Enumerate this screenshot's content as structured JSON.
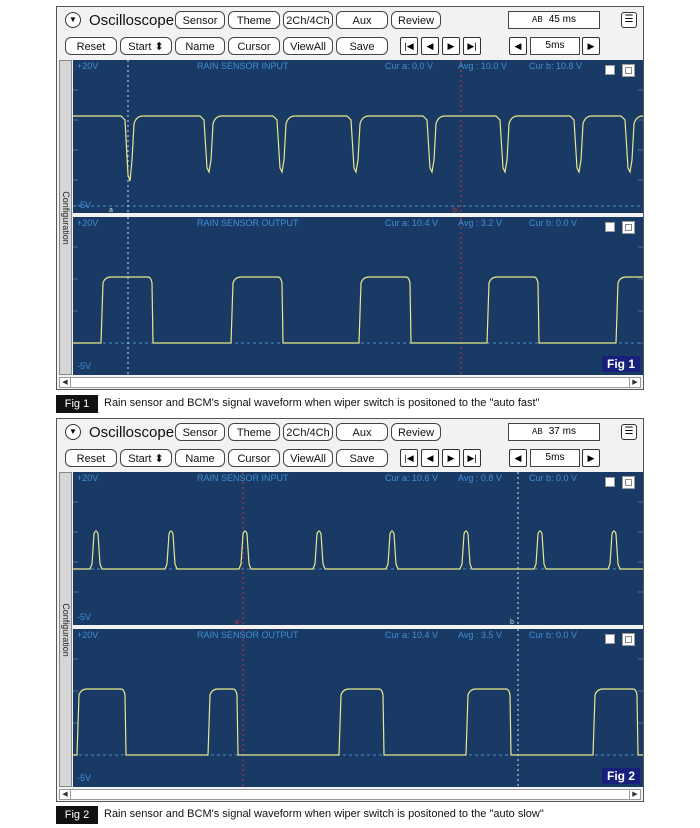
{
  "toolbar": {
    "dropdown_icon": "dropdown-circle-icon",
    "title": "Oscilloscope",
    "buttons": [
      "Sensor",
      "Theme",
      "2Ch/4Ch",
      "Aux",
      "Review"
    ],
    "row2_buttons": [
      "Reset",
      "Start",
      "Name",
      "Cursor",
      "ViewAll",
      "Save"
    ],
    "start_arrows": "⬍",
    "nav_icons": [
      "first-icon",
      "prev-icon",
      "next-icon",
      "last-icon"
    ],
    "time_div": "5ms",
    "menu_icon": "list-menu-icon"
  },
  "sidebar_label": "Configuration",
  "figures": [
    {
      "time_readout": "45 ms",
      "channels": [
        {
          "top_label": "+20V",
          "bottom_label": "-5V",
          "name": "RAIN SENSOR INPUT",
          "cur_a": "Cur a: 0.0 V",
          "avg": "Avg : 10.0 V",
          "cur_b": "Cur b: 10.8 V",
          "marker_a": "a",
          "marker_b": "b"
        },
        {
          "top_label": "+20V",
          "bottom_label": "-5V",
          "name": "RAIN SENSOR OUTPUT",
          "cur_a": "Cur a: 10.4 V",
          "avg": "Avg : 3.2 V",
          "cur_b": "Cur b: 0.0 V"
        }
      ],
      "fig_label": "Fig 1",
      "caption_tag": "Fig 1",
      "caption": "Rain sensor and BCM's signal waveform when wiper switch is positoned to the \"auto fast\""
    },
    {
      "time_readout": "37 ms",
      "channels": [
        {
          "top_label": "+20V",
          "bottom_label": "-5V",
          "name": "RAIN SENSOR INPUT",
          "cur_a": "Cur a: 10.6 V",
          "avg": "Avg : 0.8 V",
          "cur_b": "Cur b: 0.0 V",
          "marker_a": "a",
          "marker_b": "b"
        },
        {
          "top_label": "+20V",
          "bottom_label": "-5V",
          "name": "RAIN SENSOR OUTPUT",
          "cur_a": "Cur a: 10.4 V",
          "avg": "Avg : 3.5 V",
          "cur_b": "Cur b: 0.0 V"
        }
      ],
      "fig_label": "Fig 2",
      "caption_tag": "Fig 2",
      "caption": "Rain sensor and BCM's signal waveform when wiper switch is positoned to the \"auto slow\""
    }
  ],
  "colors": {
    "screen": "#1a3a66",
    "trace": "#e6e88a",
    "label": "#3f8fd1",
    "cursor_a": "#dddddd",
    "cursor_b": "#cc3333",
    "fig_badge": "#16207a"
  }
}
